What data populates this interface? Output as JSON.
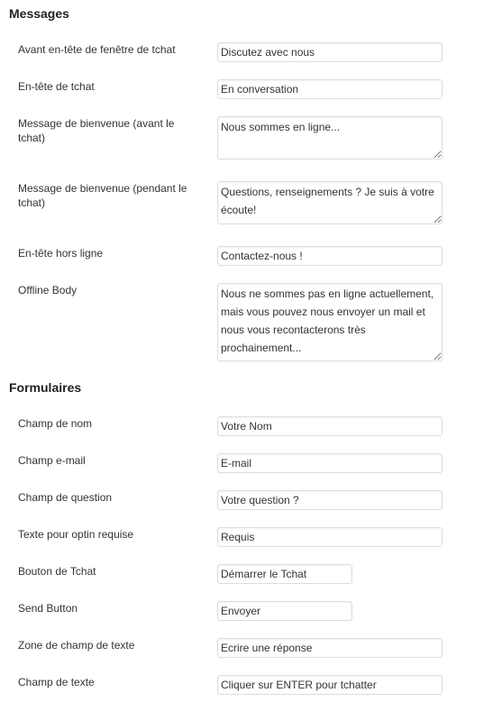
{
  "sections": {
    "messages": {
      "title": "Messages",
      "fields": [
        {
          "label": "Avant en-tête de fenêtre de tchat",
          "value": "Discutez avec nous"
        },
        {
          "label": "En-tête de tchat",
          "value": "En conversation"
        },
        {
          "label": "Message de bienvenue (avant le tchat)",
          "value": "Nous sommes en ligne..."
        },
        {
          "label": "Message de bienvenue (pendant le tchat)",
          "value": "Questions, renseignements ? Je suis à votre écoute!"
        },
        {
          "label": "En-tête hors ligne",
          "value": "Contactez-nous !"
        },
        {
          "label": "Offline Body",
          "value": "Nous ne sommes pas en ligne actuellement, mais vous pouvez nous envoyer un mail et nous vous recontacterons très prochainement..."
        }
      ]
    },
    "forms": {
      "title": "Formulaires",
      "fields": [
        {
          "label": "Champ de nom",
          "value": "Votre Nom"
        },
        {
          "label": "Champ e-mail",
          "value": "E-mail"
        },
        {
          "label": "Champ de question",
          "value": "Votre question ?"
        },
        {
          "label": "Texte pour optin requise",
          "value": "Requis"
        },
        {
          "label": "Bouton de Tchat",
          "value": "Démarrer le Tchat"
        },
        {
          "label": "Send Button",
          "value": "Envoyer"
        },
        {
          "label": "Zone de champ de texte",
          "value": "Ecrire une réponse"
        },
        {
          "label": "Champ de texte",
          "value": "Cliquer sur ENTER pour tchatter"
        }
      ]
    }
  }
}
